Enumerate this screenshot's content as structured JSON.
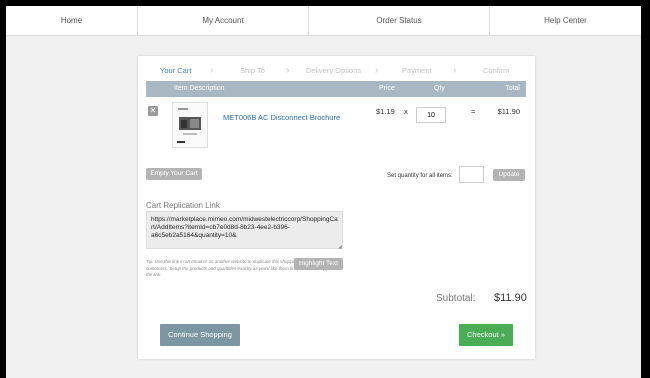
{
  "nav": {
    "home": "Home",
    "my_account": "My Account",
    "order_status": "Order Status",
    "help_center": "Help Center"
  },
  "steps": [
    "Your Cart",
    "Ship To",
    "Delivery Options",
    "Payment",
    "Confirm"
  ],
  "steps_chevron": "›",
  "table": {
    "headers": {
      "description": "Item Description",
      "price": "Price",
      "qty": "Qty",
      "total": "Total"
    }
  },
  "item": {
    "remove_icon": "✕",
    "name": "MET006B AC Disconnect Brochure",
    "price": "$1.19",
    "times": "x",
    "qty": "10",
    "equals": "=",
    "total": "$11.90"
  },
  "actions": {
    "empty_cart": "Empty Your Cart",
    "set_qty_label": "Set quantity for all items:",
    "update": "Update"
  },
  "replication": {
    "title": "Cart Replication Link",
    "link": "https://marketplace.mimeo.com/midwestelectriccorp/ShoppingCart/AddItems?itemId=cb7e0d8d-8b23-4ee2-b396-a6c5eb2a5164&quantity=10&",
    "tip": "Tip: Use this link in an email or on another website to duplicate this shopping cart for your customers. Setup the products and quantities exactly as you'd like them first, and then copy the link.",
    "highlight_button": "Highlight Text"
  },
  "summary": {
    "subtotal_label": "Subtotal:",
    "subtotal_value": "$11.90"
  },
  "buttons": {
    "continue_shopping": "Continue Shopping",
    "checkout": "Checkout »"
  },
  "colors": {
    "active_step": "#3a86c8",
    "header_bar": "#a8b7c2",
    "checkout": "#4aac55",
    "continue": "#7c96a2"
  }
}
